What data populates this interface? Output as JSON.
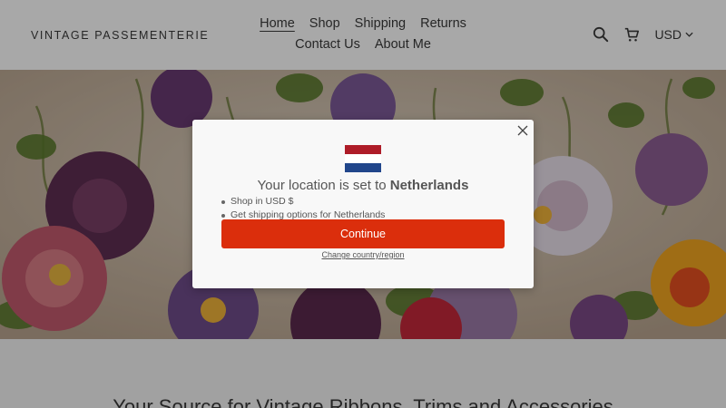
{
  "header": {
    "brand": "VINTAGE PASSEMENTERIE",
    "nav": [
      {
        "label": "Home",
        "active": true
      },
      {
        "label": "Shop",
        "active": false
      },
      {
        "label": "Shipping",
        "active": false
      },
      {
        "label": "Returns",
        "active": false
      },
      {
        "label": "Contact Us",
        "active": false
      },
      {
        "label": "About Me",
        "active": false
      }
    ],
    "icons": [
      "search-icon",
      "cart-icon"
    ],
    "currency": "USD"
  },
  "hero": {
    "alt": "ribbon flowers"
  },
  "below": {
    "heading": "Your Source for Vintage Ribbons, Trims and Accessories"
  },
  "modal": {
    "title_prefix": "Your location is set to",
    "country": "Netherlands",
    "bullets": [
      "Shop in USD $",
      "Get shipping options for Netherlands"
    ],
    "continue_label": "Continue",
    "change_link": "Change country/region",
    "flag_colors": [
      "#ae1c28",
      "#ffffff",
      "#21468b"
    ]
  },
  "colors": {
    "accent": "#db2e0c",
    "text": "#3a3a3a"
  }
}
